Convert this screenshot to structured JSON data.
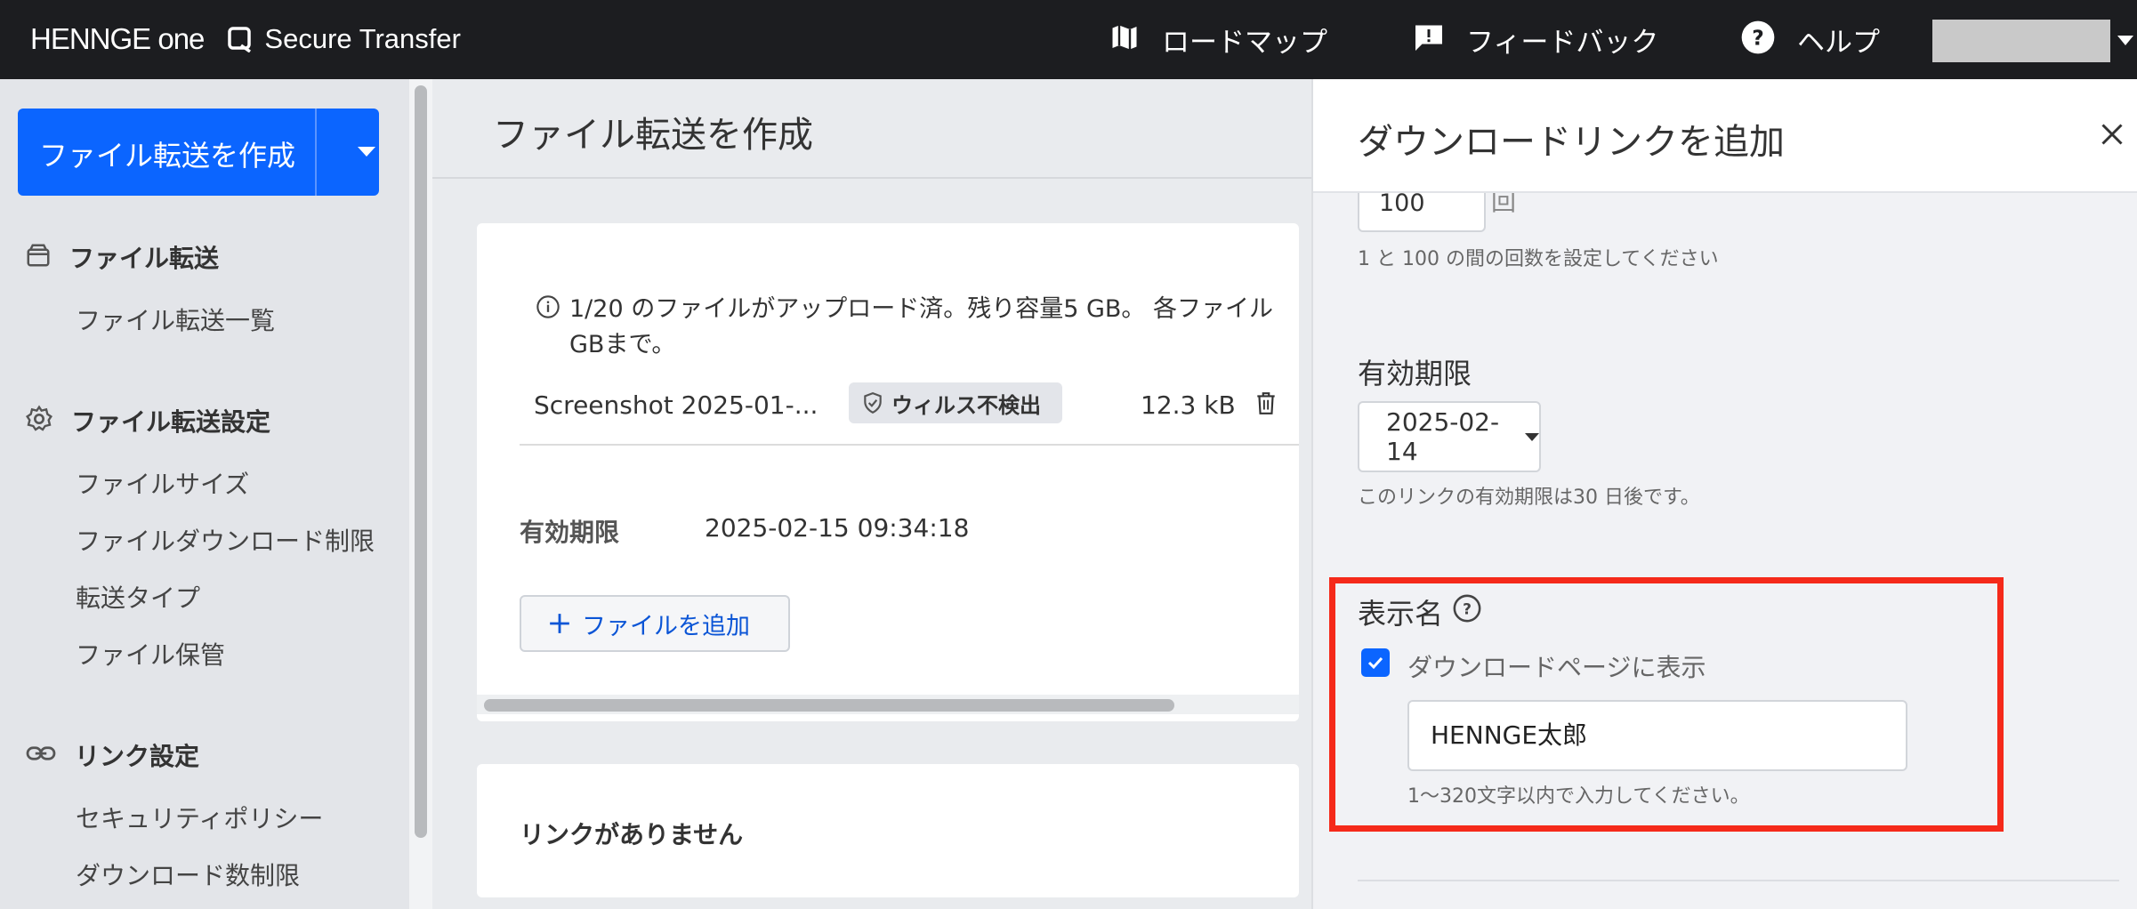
{
  "header": {
    "logo": "HENNGE one",
    "product": "Secure Transfer",
    "nav": [
      {
        "icon": "map-icon",
        "label": "ロードマップ"
      },
      {
        "icon": "feedback-icon",
        "label": "フィードバック"
      },
      {
        "icon": "help-icon",
        "label": "ヘルプ"
      }
    ]
  },
  "sidebar": {
    "create_button": "ファイル転送を作成",
    "sections": [
      {
        "icon": "box-icon",
        "label": "ファイル転送",
        "items": [
          "ファイル転送一覧"
        ]
      },
      {
        "icon": "gear-icon",
        "label": "ファイル転送設定",
        "items": [
          "ファイルサイズ",
          "ファイルダウンロード制限",
          "転送タイプ",
          "ファイル保管"
        ]
      },
      {
        "icon": "link-icon",
        "label": "リンク設定",
        "items": [
          "セキュリティポリシー",
          "ダウンロード数制限"
        ]
      }
    ]
  },
  "main": {
    "title": "ファイル転送を作成",
    "upload_info_line1": "1/20 のファイルがアップロード済。残り容量5 GB。 各ファイル",
    "upload_info_line2": "GBまで。",
    "file": {
      "name": "Screenshot 2025-01-...",
      "badge": "ウィルス不検出",
      "size": "12.3 kB"
    },
    "expiry_label": "有効期限",
    "expiry_value": "2025-02-15 09:34:18",
    "add_file_button": "ファイルを追加",
    "no_links": "リンクがありません"
  },
  "drawer": {
    "title": "ダウンロードリンクを追加",
    "count_value": "100",
    "count_unit": "回",
    "count_hint": "1 と 100 の間の回数を設定してください",
    "expiry_label": "有効期限",
    "expiry_date": "2025-02-14",
    "expiry_hint": "このリンクの有効期限は30 日後です。",
    "display_name_label": "表示名",
    "show_on_page_label": "ダウンロードページに表示",
    "display_name_value": "HENNGE太郎",
    "display_name_hint": "1〜320文字以内で入力してください。"
  },
  "colors": {
    "accent": "#0b65ff",
    "highlight": "#f52a1a",
    "header_bg": "#1c1d20"
  }
}
